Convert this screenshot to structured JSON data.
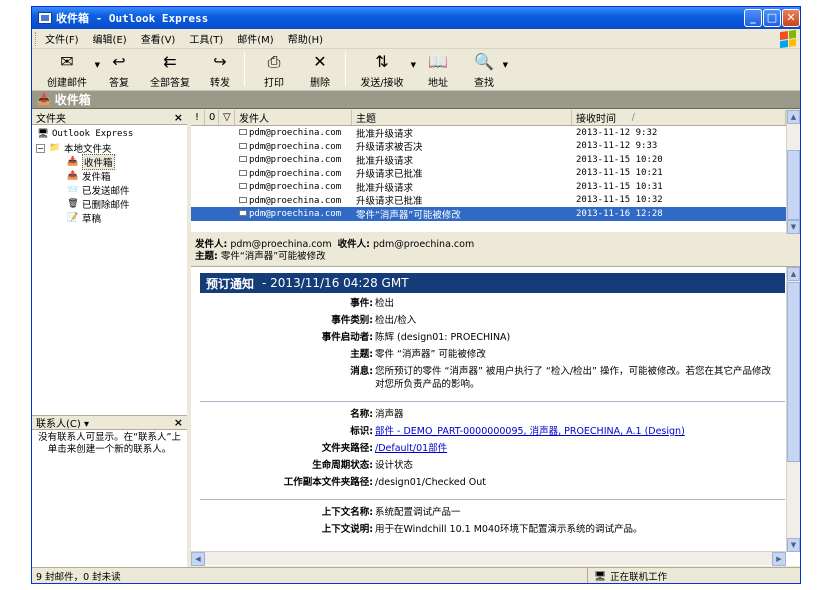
{
  "window": {
    "title": "收件箱 - Outlook Express"
  },
  "menu": [
    "文件(F)",
    "编辑(E)",
    "查看(V)",
    "工具(T)",
    "邮件(M)",
    "帮助(H)"
  ],
  "toolbar": [
    {
      "label": "创建邮件",
      "icon": "new-mail-icon",
      "glyph": "✉",
      "dropdown": true
    },
    {
      "label": "答复",
      "icon": "reply-icon",
      "glyph": "↩",
      "dropdown": false
    },
    {
      "label": "全部答复",
      "icon": "reply-all-icon",
      "glyph": "⇇",
      "dropdown": false
    },
    {
      "label": "转发",
      "icon": "forward-icon",
      "glyph": "↪",
      "dropdown": false
    },
    {
      "label": "打印",
      "icon": "print-icon",
      "glyph": "⎙",
      "dropdown": false
    },
    {
      "label": "删除",
      "icon": "delete-icon",
      "glyph": "✕",
      "dropdown": false
    },
    {
      "label": "发送/接收",
      "icon": "send-receive-icon",
      "glyph": "⇅",
      "dropdown": true
    },
    {
      "label": "地址",
      "icon": "address-book-icon",
      "glyph": "📖",
      "dropdown": false
    },
    {
      "label": "查找",
      "icon": "find-icon",
      "glyph": "🔍",
      "dropdown": true
    }
  ],
  "folder_bar": {
    "title": "收件箱"
  },
  "folders_pane": {
    "title": "文件夹",
    "close": "×"
  },
  "tree": [
    {
      "label": "Outlook Express",
      "indent": 0,
      "icon": "outlook-express-icon",
      "glyph": "🖥",
      "mono": true
    },
    {
      "label": "本地文件夹",
      "indent": 1,
      "icon": "local-folders-icon",
      "glyph": "📁",
      "expander": "−"
    },
    {
      "label": "收件箱",
      "indent": 2,
      "icon": "inbox-icon",
      "glyph": "📥",
      "selected": true
    },
    {
      "label": "发件箱",
      "indent": 2,
      "icon": "outbox-icon",
      "glyph": "📤"
    },
    {
      "label": "已发送邮件",
      "indent": 2,
      "icon": "sent-items-icon",
      "glyph": "📨"
    },
    {
      "label": "已删除邮件",
      "indent": 2,
      "icon": "deleted-items-icon",
      "glyph": "🗑"
    },
    {
      "label": "草稿",
      "indent": 2,
      "icon": "drafts-icon",
      "glyph": "📝"
    }
  ],
  "contacts": {
    "title": "联系人(C) ▾",
    "close": "×",
    "text": "没有联系人可显示。在“联系人”上单击来创建一个新的联系人。"
  },
  "columns": {
    "priority": "!",
    "attachment": "0",
    "flag": "▽",
    "from": "发件人",
    "subject": "主题",
    "received": "接收时间",
    "sort": "/"
  },
  "messages": [
    {
      "from": "pdm@proechina.com",
      "subject": "批准升级请求",
      "received": "2013-11-12 9:32"
    },
    {
      "from": "pdm@proechina.com",
      "subject": "升级请求被否决",
      "received": "2013-11-12 9:33"
    },
    {
      "from": "pdm@proechina.com",
      "subject": "批准升级请求",
      "received": "2013-11-15 10:20"
    },
    {
      "from": "pdm@proechina.com",
      "subject": "升级请求已批准",
      "received": "2013-11-15 10:21"
    },
    {
      "from": "pdm@proechina.com",
      "subject": "批准升级请求",
      "received": "2013-11-15 10:31"
    },
    {
      "from": "pdm@proechina.com",
      "subject": "升级请求已批准",
      "received": "2013-11-15 10:32"
    },
    {
      "from": "pdm@proechina.com",
      "subject": "零件“消声器”可能被修改",
      "received": "2013-11-16 12:28",
      "selected": true
    }
  ],
  "preview_header": {
    "from_label": "发件人:",
    "from": "pdm@proechina.com",
    "to_label": "收件人:",
    "to": "pdm@proechina.com",
    "subject_label": "主题:",
    "subject": "零件“消声器”可能被修改"
  },
  "notice": {
    "title": "预订通知",
    "datetime": "- 2013/11/16 04:28 GMT"
  },
  "fields_1": [
    {
      "k": "事件:",
      "v": "检出"
    },
    {
      "k": "事件类别:",
      "v": "检出/检入"
    },
    {
      "k": "事件启动者:",
      "v": "陈辉 (design01: PROECHINA)"
    },
    {
      "k": "主题:",
      "v": "零件 “消声器” 可能被修改"
    },
    {
      "k": "消息:",
      "v": "您所预订的零件 “消声器” 被用户执行了 “检入/检出” 操作，可能被修改。若您在其它产品修改对您所负责产品的影响。"
    }
  ],
  "fields_2": [
    {
      "k": "名称:",
      "v": "消声器"
    },
    {
      "k": "标识:",
      "v": "部件 - DEMO_PART-0000000095, 消声器, PROECHINA, A.1 (Design)",
      "link": true
    },
    {
      "k": "文件夹路径:",
      "v": "/Default/01部件",
      "link": true
    },
    {
      "k": "生命周期状态:",
      "v": "设计状态"
    },
    {
      "k": "工作副本文件夹路径:",
      "v": "/design01/Checked Out"
    }
  ],
  "fields_3": [
    {
      "k": "上下文名称:",
      "v": "系统配置调试产品一"
    },
    {
      "k": "上下文说明:",
      "v": "用于在Windchill 10.1 M040环境下配置演示系统的调试产品。"
    }
  ],
  "status": {
    "left": "9 封邮件，0 封未读",
    "right": "正在联机工作"
  }
}
